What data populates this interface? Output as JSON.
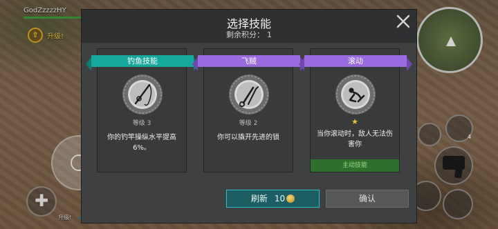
{
  "hud": {
    "player_name": "GodZzzzzHY",
    "level_up_top": "升级!",
    "level_up_bottom": "升级!",
    "side_count": "4"
  },
  "dialog": {
    "title": "选择技能",
    "points_label": "剩余积分：",
    "points_value": "1",
    "close_icon": "close-icon"
  },
  "skills": [
    {
      "name": "钓鱼技能",
      "ribbon_color": "#16a89c",
      "icon": "fishing-rod-icon",
      "level": "等级 3",
      "description": "你的钓竿操纵水平提高6%。"
    },
    {
      "name": "飞贼",
      "ribbon_color": "#9a6ae0",
      "icon": "lockpick-icon",
      "level": "等级 2",
      "description": "你可以撬开先进的锁"
    },
    {
      "name": "滚动",
      "ribbon_color": "#9a6ae0",
      "icon": "roll-icon",
      "stars": "★",
      "description": "当你滚动时，敌人无法伤害你",
      "tag": "主动技能"
    }
  ],
  "buttons": {
    "refresh_label": "刷新",
    "refresh_cost": "10",
    "refresh_currency_icon": "coin-icon",
    "confirm_label": "确认"
  },
  "colors": {
    "teal": "#16a89c",
    "purple": "#9a6ae0",
    "active_green": "#2f6f2c",
    "refresh_border": "#2ec0c6"
  }
}
